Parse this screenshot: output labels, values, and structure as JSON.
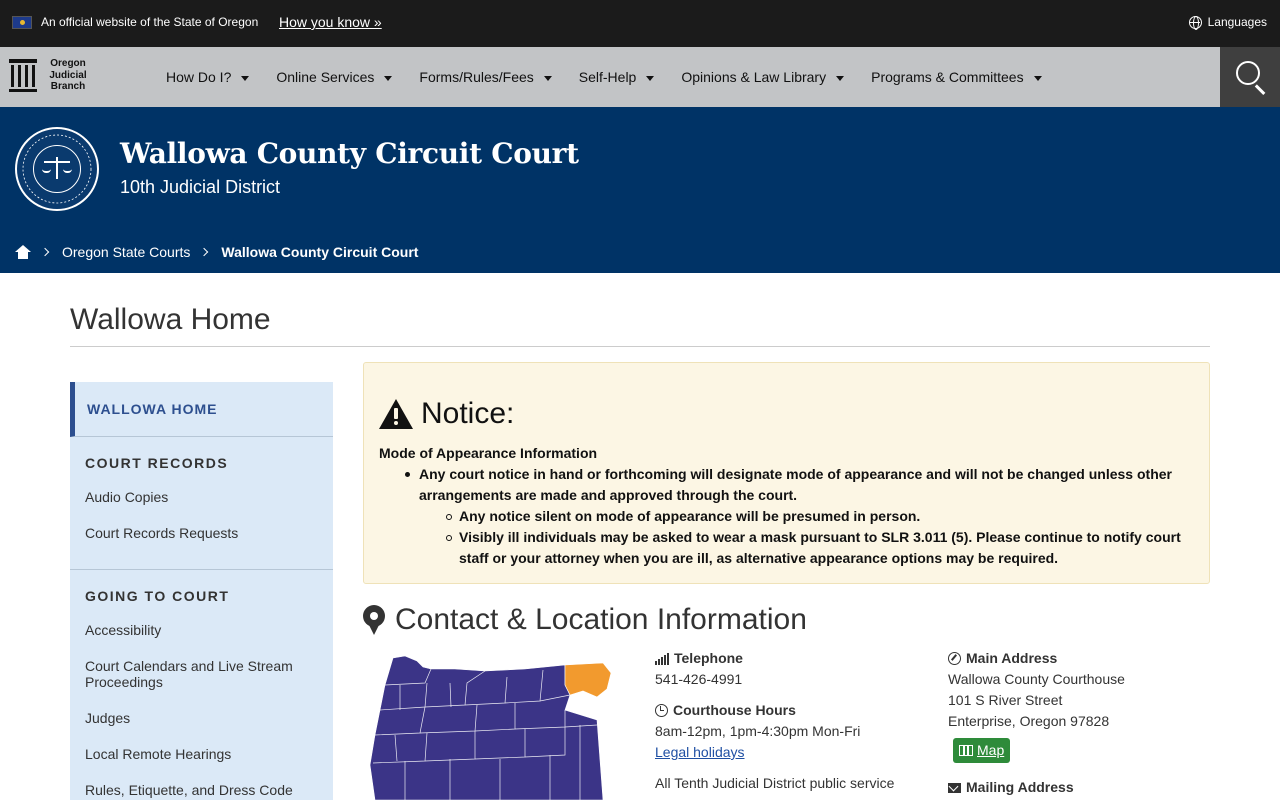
{
  "official_bar": {
    "text": "An official website of the State of Oregon",
    "how_link": "How you know »",
    "languages": "Languages"
  },
  "nav": {
    "logo_lines": [
      "Oregon",
      "Judicial",
      "Branch"
    ],
    "items": [
      "How Do I?",
      "Online Services",
      "Forms/Rules/Fees",
      "Self-Help",
      "Opinions & Law Library",
      "Programs & Committees"
    ]
  },
  "banner": {
    "title": "Wallowa County Circuit Court",
    "subtitle": "10th Judicial District",
    "breadcrumb": [
      "Oregon State Courts",
      "Wallowa County Circuit Court"
    ]
  },
  "page": {
    "title": "Wallowa Home"
  },
  "sidebar": {
    "active": "WALLOWA HOME",
    "sections": [
      {
        "heading": "COURT RECORDS",
        "links": [
          "Audio Copies",
          "Court Records Requests"
        ]
      },
      {
        "heading": "GOING TO COURT",
        "links": [
          "Accessibility",
          "Court Calendars and Live Stream Proceedings",
          "Judges",
          "Local Remote Hearings",
          "Rules, Etiquette, and Dress Code"
        ]
      }
    ]
  },
  "notice": {
    "heading": "Notice:",
    "intro": "Mode of Appearance Information",
    "item": "Any court notice in hand or forthcoming will designate mode of appearance and will not be changed unless other arrangements are made and approved through the court.",
    "subitems": [
      "Any notice silent on mode of appearance will be presumed in person.",
      "Visibly ill individuals may be asked to wear a mask pursuant to SLR 3.011 (5). Please continue to notify court staff or your attorney when you are ill, as alternative appearance options may be required."
    ]
  },
  "contact": {
    "heading": "Contact & Location Information",
    "telephone_label": "Telephone",
    "telephone": "541-426-4991",
    "hours_label": "Courthouse Hours",
    "hours": "8am-12pm, 1pm-4:30pm Mon-Fri",
    "holidays_link": "Legal holidays",
    "note": "All Tenth Judicial District public service",
    "main_address_label": "Main Address",
    "address_lines": [
      "Wallowa County Courthouse",
      "101 S River Street",
      "Enterprise, Oregon 97828"
    ],
    "map_button": "Map",
    "mailing_label": "Mailing Address"
  },
  "colors": {
    "banner": "#003366",
    "map_state": "#3b3487",
    "map_county_highlight": "#f29a2e",
    "notice_bg": "#fcf6e4"
  }
}
